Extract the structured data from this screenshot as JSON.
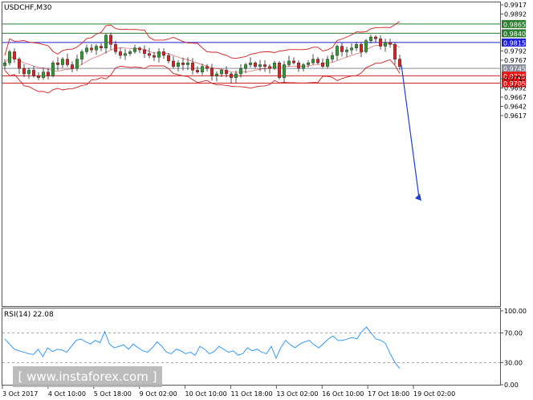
{
  "symbol_label": "USDCHF,M30",
  "rsi_label": "RSI(14) 22.08",
  "watermark": "[ www.instaforex.com ]",
  "chart_data": {
    "type": "candlestick",
    "symbol": "USDCHF",
    "timeframe": "M30",
    "price_ticks": [
      "0.9917",
      "0.9892",
      "0.9792",
      "0.9767",
      "0.9717",
      "0.9692",
      "0.9667",
      "0.9642",
      "0.9617"
    ],
    "price_ylim": [
      0.9595,
      0.9922
    ],
    "levels": [
      {
        "label": "0.9865",
        "value": 0.9865,
        "color": "#2e7d32",
        "label_bg": "#2e7d32",
        "label_fg": "#ffffff"
      },
      {
        "label": "0.9840",
        "value": 0.984,
        "color": "#2e7d32",
        "label_bg": "#2e7d32",
        "label_fg": "#ffffff"
      },
      {
        "label": "0.9815",
        "value": 0.9815,
        "color": "#1f1fd6",
        "label_bg": "#1f1fd6",
        "label_fg": "#ffffff"
      },
      {
        "label": "0.9745",
        "value": 0.9745,
        "color": "#8c8c9c",
        "label_bg": "#8c8c9c",
        "label_fg": "#ffffff"
      },
      {
        "label": "0.9725",
        "value": 0.9725,
        "color": "#cc2222",
        "label_bg": "#e11",
        "label_fg": "#ffffff"
      },
      {
        "label": "0.9705",
        "value": 0.9705,
        "color": "#cc2222",
        "label_bg": "#e11",
        "label_fg": "#ffffff"
      }
    ],
    "x_labels": [
      "3 Oct 2017",
      "4 Oct 10:00",
      "5 Oct 18:00",
      "9 Oct 02:00",
      "10 Oct 10:00",
      "11 Oct 18:00",
      "13 Oct 02:00",
      "16 Oct 10:00",
      "17 Oct 18:00",
      "19 Oct 02:00"
    ],
    "rsi_ticks": [
      "100.00",
      "70.00",
      "30.00",
      "0.00"
    ],
    "rsi_levels": [
      70,
      30
    ],
    "rsi_last": 22.08,
    "price_path": [
      0.976,
      0.979,
      0.977,
      0.9745,
      0.973,
      0.974,
      0.9725,
      0.972,
      0.9735,
      0.9725,
      0.976,
      0.9755,
      0.977,
      0.9755,
      0.9745,
      0.977,
      0.979,
      0.98,
      0.9795,
      0.9805,
      0.98,
      0.9835,
      0.981,
      0.979,
      0.978,
      0.9785,
      0.979,
      0.98,
      0.9795,
      0.9785,
      0.978,
      0.9775,
      0.979,
      0.978,
      0.9765,
      0.975,
      0.976,
      0.9755,
      0.976,
      0.974,
      0.9735,
      0.975,
      0.9745,
      0.9725,
      0.973,
      0.974,
      0.973,
      0.972,
      0.973,
      0.9745,
      0.9755,
      0.976,
      0.975,
      0.9755,
      0.975,
      0.9745,
      0.976,
      0.972,
      0.9755,
      0.9765,
      0.976,
      0.9745,
      0.9755,
      0.976,
      0.977,
      0.976,
      0.975,
      0.977,
      0.978,
      0.9805,
      0.979,
      0.9795,
      0.98,
      0.981,
      0.979,
      0.982,
      0.983,
      0.9825,
      0.9805,
      0.9815,
      0.981,
      0.977,
      0.975
    ],
    "rsi_path": [
      62,
      55,
      48,
      46,
      44,
      42,
      41,
      48,
      38,
      50,
      45,
      48,
      47,
      44,
      52,
      60,
      62,
      58,
      55,
      60,
      57,
      72,
      55,
      50,
      52,
      54,
      48,
      55,
      50,
      46,
      44,
      50,
      58,
      52,
      44,
      42,
      48,
      46,
      42,
      44,
      40,
      52,
      48,
      42,
      45,
      52,
      48,
      44,
      46,
      40,
      42,
      50,
      46,
      48,
      44,
      42,
      52,
      36,
      50,
      60,
      54,
      50,
      55,
      58,
      60,
      54,
      50,
      56,
      62,
      66,
      60,
      60,
      62,
      64,
      62,
      72,
      78,
      70,
      62,
      60,
      56,
      42,
      30,
      22
    ]
  }
}
